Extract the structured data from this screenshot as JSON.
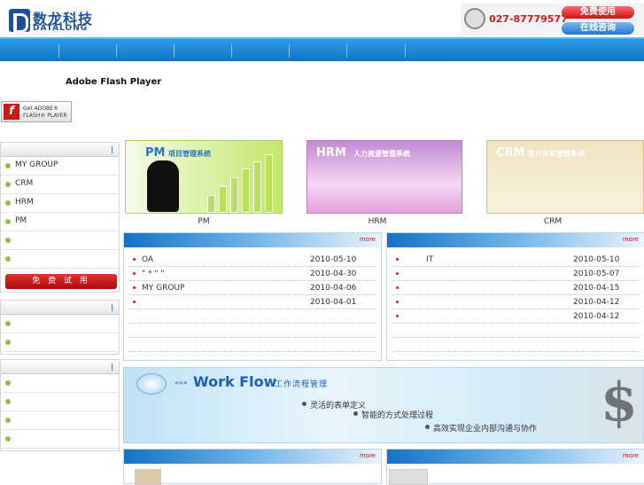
{
  "header": {
    "logo_cn": "数龙科技",
    "logo_en": "DATALONG",
    "phone": "027-87779577",
    "free_use_label": "免费使用",
    "online_consult_label": "在线咨询"
  },
  "flash": {
    "title": "Adobe Flash Player",
    "badge_line1": "Get ADOBE®",
    "badge_line2": "FLASH® PLAYER",
    "badge_logo": "f"
  },
  "sidebar": {
    "box1": {
      "head": "|",
      "items": [
        {
          "label": "MY GROUP"
        },
        {
          "label": "CRM"
        },
        {
          "label": "HRM"
        },
        {
          "label": "PM"
        },
        {
          "label": ""
        },
        {
          "label": ""
        }
      ],
      "trial_label": "免 费 试 用"
    },
    "box2": {
      "head": "|",
      "items": [
        {
          "label": ""
        },
        {
          "label": ""
        }
      ]
    },
    "box3": {
      "head": "|",
      "items": [
        {
          "label": ""
        },
        {
          "label": ""
        },
        {
          "label": ""
        },
        {
          "label": ""
        }
      ]
    }
  },
  "banners": [
    {
      "title": "PM",
      "subtitle": "项目管理系统",
      "caption": "PM"
    },
    {
      "title": "HRM",
      "subtitle": "人力资源管理系统",
      "caption": "HRM"
    },
    {
      "title": "CRM",
      "subtitle": "客户关系管理系统",
      "caption": "CRM"
    }
  ],
  "news_left": {
    "more": "more",
    "rows": [
      {
        "title": "OA",
        "date": "2010-05-10"
      },
      {
        "title": "\" * \" \"",
        "date": "2010-04-30"
      },
      {
        "title": "MY GROUP",
        "date": "2010-04-06"
      },
      {
        "title": "",
        "date": "2010-04-01"
      }
    ]
  },
  "news_right": {
    "more": "more",
    "rows": [
      {
        "title": "IT",
        "date": "2010-05-10"
      },
      {
        "title": "",
        "date": "2010-05-07"
      },
      {
        "title": "",
        "date": "2010-04-15"
      },
      {
        "title": "",
        "date": "2010-04-12"
      },
      {
        "title": "",
        "date": "2010-04-12"
      }
    ]
  },
  "workflow": {
    "arrows": "»»»",
    "title": "Work Flow",
    "subtitle": "工作流程管理",
    "bullets": [
      "灵活的表单定义",
      "智能的方式处理过程",
      "高效实现企业内部沟通与协作"
    ],
    "dollar": "$"
  },
  "bottom_boxes": [
    {
      "more": "more"
    },
    {
      "more": "more"
    }
  ]
}
